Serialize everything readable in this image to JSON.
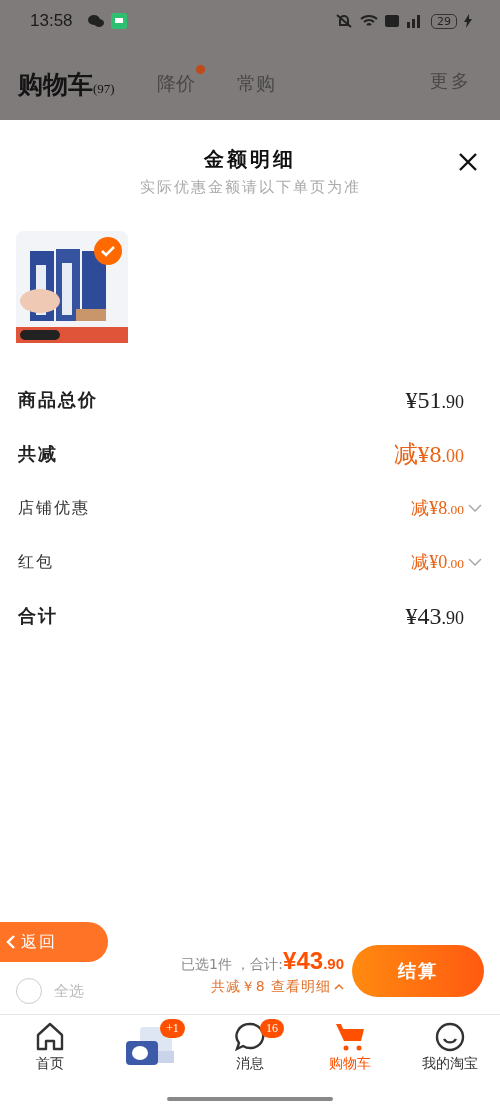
{
  "status_bar": {
    "time": "13:58",
    "battery": "29"
  },
  "header": {
    "tabs": [
      {
        "label": "购物车",
        "count": "(97)",
        "selected": true,
        "dot": false
      },
      {
        "label": "降价",
        "selected": false,
        "dot": true
      },
      {
        "label": "常购",
        "selected": false,
        "dot": false
      }
    ],
    "more": "更多"
  },
  "sheet": {
    "title": "金额明细",
    "subtitle": "实际优惠金额请以下单页为准",
    "products": [
      {
        "kind": "picture",
        "checked": true
      }
    ],
    "rows": [
      {
        "label": "商品总价",
        "amount": "¥51",
        "decimals": ".90",
        "bold": true,
        "discount": false,
        "expandable": false
      },
      {
        "label": "共减",
        "amount": "减¥8",
        "decimals": ".00",
        "bold": true,
        "discount": true,
        "expandable": false
      },
      {
        "label": "店铺优惠",
        "amount": "减¥8",
        "decimals": ".00",
        "bold": false,
        "discount": true,
        "expandable": true
      },
      {
        "label": "红包",
        "amount": "减¥0",
        "decimals": ".00",
        "bold": false,
        "discount": true,
        "expandable": true
      },
      {
        "label": "合计",
        "amount": "¥43",
        "decimals": ".90",
        "bold": true,
        "discount": false,
        "expandable": false
      }
    ]
  },
  "bottom_bar": {
    "back": "返回",
    "select_all": {
      "label": "全选",
      "checked": false
    },
    "selected_count": "已选1件 ，合计:",
    "total": "¥43",
    "total_decimals": ".90",
    "discount_link": "共减￥8 查看明细",
    "checkout": "结算"
  },
  "tab_bar": [
    {
      "kind": "home",
      "label": "首页",
      "selected": false
    },
    {
      "kind": "promo",
      "badge": "+1",
      "selected": false
    },
    {
      "kind": "message",
      "label": "消息",
      "badge": "16",
      "selected": false
    },
    {
      "kind": "cart",
      "label": "购物车",
      "selected": true
    },
    {
      "kind": "profile",
      "label": "我的淘宝",
      "selected": false
    }
  ]
}
